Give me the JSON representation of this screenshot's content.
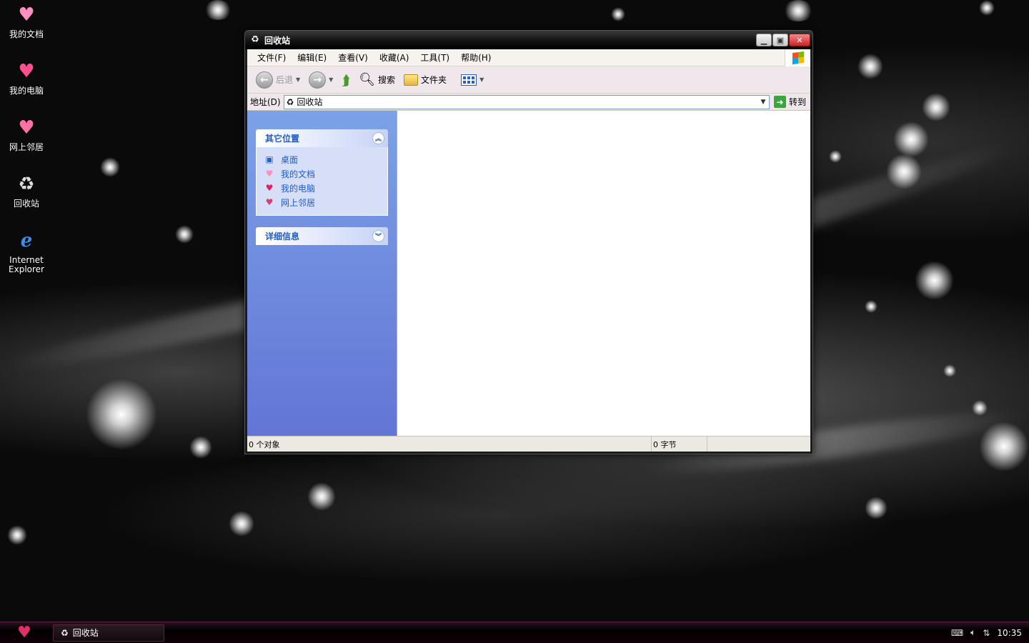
{
  "desktop": {
    "icons": [
      {
        "label": "我的文档",
        "glyph": "♥"
      },
      {
        "label": "我的电脑",
        "glyph": "♥"
      },
      {
        "label": "网上邻居",
        "glyph": "♥"
      },
      {
        "label": "回收站",
        "glyph": "♻"
      },
      {
        "label": "Internet Explorer",
        "glyph": "e"
      }
    ]
  },
  "window": {
    "title": "回收站",
    "menu": [
      "文件(F)",
      "编辑(E)",
      "查看(V)",
      "收藏(A)",
      "工具(T)",
      "帮助(H)"
    ],
    "toolbar": {
      "back_label": "后退",
      "search_label": "搜索",
      "folders_label": "文件夹"
    },
    "address": {
      "label": "地址(D)",
      "value": "回收站",
      "go_label": "转到"
    },
    "taskpane": {
      "other_places": {
        "title": "其它位置",
        "links": [
          "桌面",
          "我的文档",
          "我的电脑",
          "网上邻居"
        ]
      },
      "details": {
        "title": "详细信息"
      }
    },
    "status": {
      "objects": "0 个对象",
      "size": "0 字节"
    }
  },
  "taskbar": {
    "task_label": "回收站",
    "clock": "10:35"
  },
  "colors": {
    "accent": "#215dc6",
    "start": "#e0306a",
    "close": "#cc2222"
  }
}
